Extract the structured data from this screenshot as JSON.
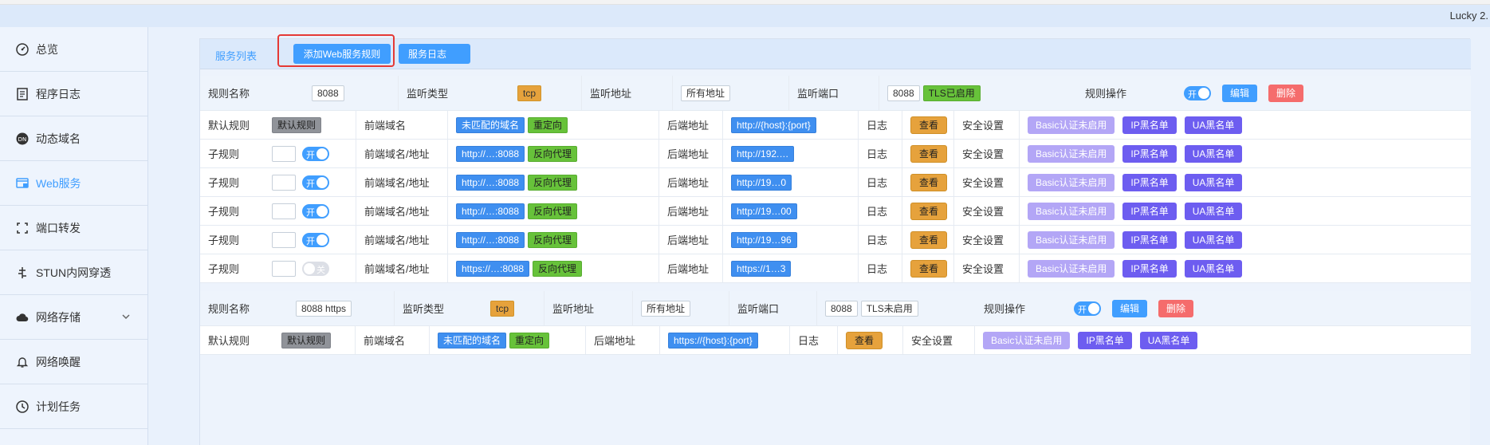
{
  "app": {
    "title": "Lucky 2."
  },
  "sidebar": {
    "items": [
      {
        "label": "总览",
        "icon": "dashboard-icon"
      },
      {
        "label": "程序日志",
        "icon": "log-icon"
      },
      {
        "label": "动态域名",
        "icon": "ddns-icon"
      },
      {
        "label": "Web服务",
        "icon": "web-service-icon",
        "active": true
      },
      {
        "label": "端口转发",
        "icon": "port-forward-icon"
      },
      {
        "label": "STUN内网穿透",
        "icon": "stun-icon"
      },
      {
        "label": "网络存储",
        "icon": "cloud-storage-icon",
        "has_submenu": true
      },
      {
        "label": "网络唤醒",
        "icon": "bell-icon"
      },
      {
        "label": "计划任务",
        "icon": "clock-icon"
      }
    ]
  },
  "tabs": {
    "list": "服务列表",
    "add_rule": "添加Web服务规则",
    "log": "服务日志"
  },
  "labels": {
    "rule_name": "规则名称",
    "listen_type": "监听类型",
    "listen_addr": "监听地址",
    "listen_port": "监听端口",
    "rule_ops": "规则操作",
    "default_rule": "默认规则",
    "sub_rule": "子规则",
    "frontend_domain": "前端域名",
    "frontend_domain_addr": "前端域名/地址",
    "backend_addr": "后端地址",
    "log": "日志",
    "security": "安全设置",
    "view": "查看",
    "basic_auth": "Basic认证未启用",
    "ip_blacklist": "IP黑名单",
    "ua_blacklist": "UA黑名单",
    "edit": "编辑",
    "delete": "删除",
    "toggle_on": "开",
    "toggle_off": "关"
  },
  "rules": [
    {
      "name": "8088",
      "type": "tcp",
      "addr": "所有地址",
      "port": "8088",
      "tls": "TLS已启用",
      "default": {
        "tag": "默认规则",
        "domain": "未匹配的域名",
        "mode": "重定向",
        "backend": "http://{host}:{port}"
      },
      "subrules": [
        {
          "frontend": "http://…:8088",
          "mode": "反向代理",
          "backend": "http://192.…",
          "enabled": true
        },
        {
          "frontend": "http://…:8088",
          "mode": "反向代理",
          "backend": "http://19…0",
          "enabled": true
        },
        {
          "frontend": "http://…:8088",
          "mode": "反向代理",
          "backend": "http://19…00",
          "enabled": true
        },
        {
          "frontend": "http://…:8088",
          "mode": "反向代理",
          "backend": "http://19…96",
          "enabled": true
        },
        {
          "frontend": "https://…:8088",
          "mode": "反向代理",
          "backend": "https://1…3",
          "enabled": false
        }
      ]
    },
    {
      "name": "8088 https",
      "type": "tcp",
      "addr": "所有地址",
      "port": "8088",
      "tls": "TLS未启用",
      "default": {
        "tag": "默认规则",
        "domain": "未匹配的域名",
        "mode": "重定向",
        "backend": "https://{host}:{port}"
      }
    }
  ]
}
